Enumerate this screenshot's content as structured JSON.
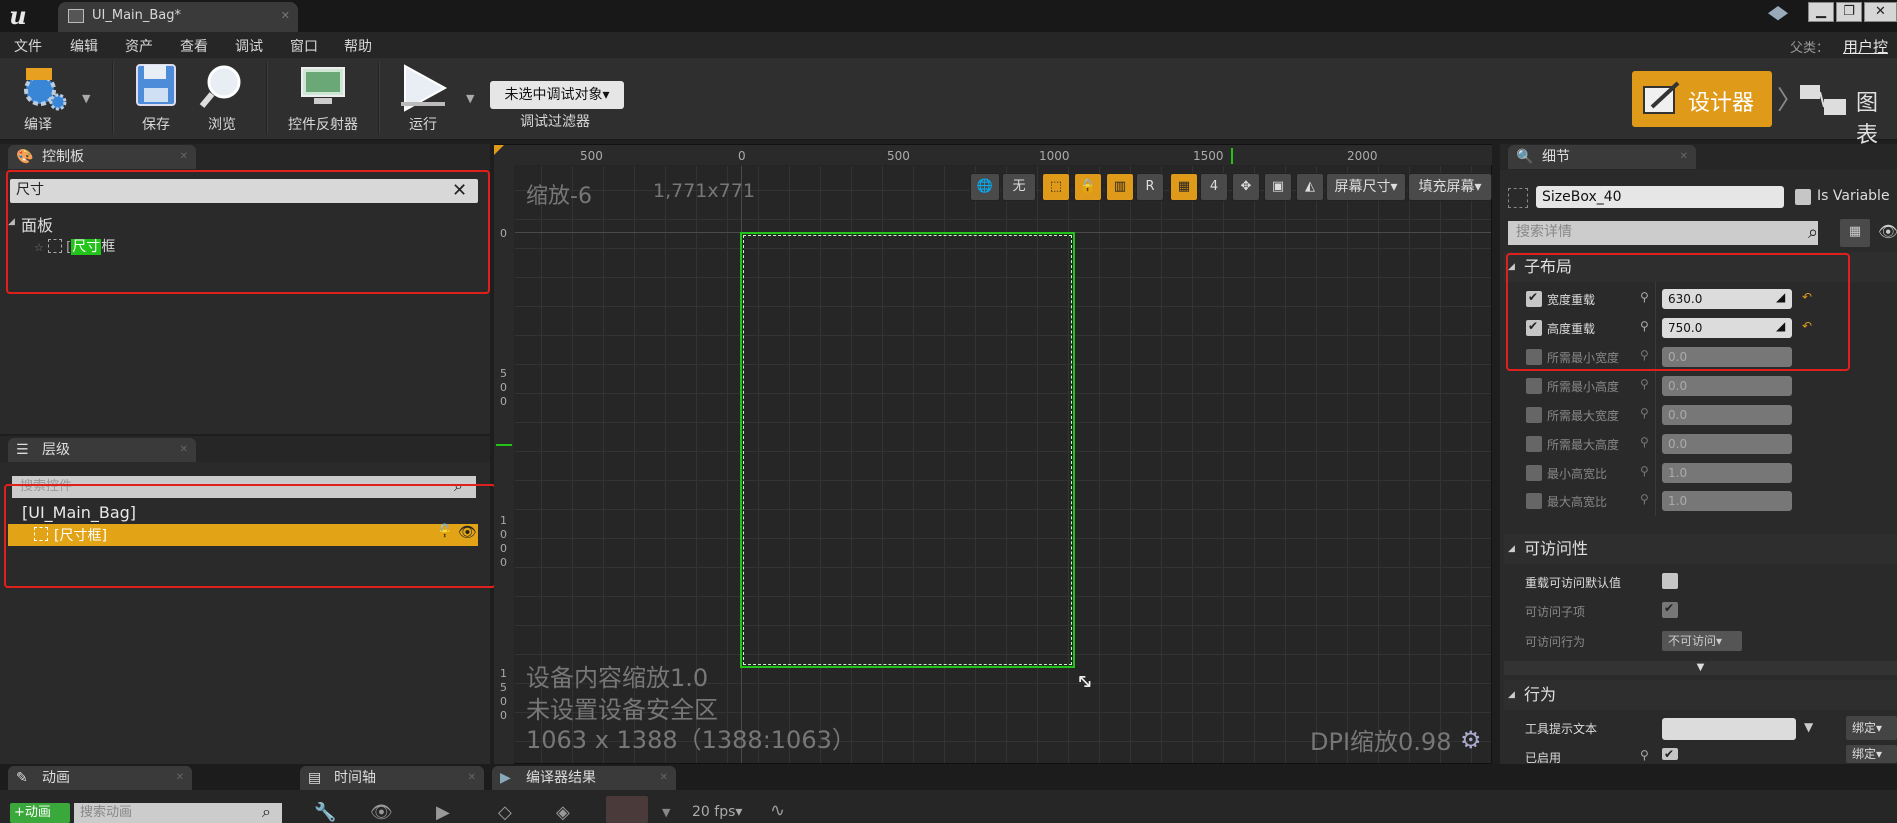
{
  "window": {
    "tab_title": "UI_Main_Bag*",
    "controls": [
      "▁",
      "❐",
      "✕"
    ]
  },
  "menu": {
    "items": [
      "文件",
      "编辑",
      "资产",
      "查看",
      "调试",
      "窗口",
      "帮助"
    ],
    "parent_label": "父类：",
    "parent_value": "用户控"
  },
  "toolbar": {
    "compile": "编译",
    "save": "保存",
    "browse": "浏览",
    "reflector": "控件反射器",
    "run": "运行",
    "debug_select": "未选中调试对象▾",
    "debug_filter": "调试过滤器",
    "designer": "设计器",
    "graph": "图表"
  },
  "palette": {
    "title": "控制板",
    "search_value": "尺寸",
    "category": "面板",
    "item_highlight": "尺寸",
    "item_suffix": "框"
  },
  "hierarchy": {
    "title": "层级",
    "search_placeholder": "搜索控件",
    "root": "[UI_Main_Bag]",
    "child": "[尺寸框]"
  },
  "canvas": {
    "zoom": "缩放-6",
    "size": "1,771x771",
    "ruler_top": [
      "500",
      "0",
      "500",
      "1000",
      "1500",
      "2000"
    ],
    "ruler_left": [
      "0",
      "5\n0\n0",
      "1\n0\n0\n0",
      "1\n5\n0\n0"
    ],
    "btn_none": "无",
    "btn_r": "R",
    "btn_4": "4",
    "screen_size": "屏幕尺寸▾",
    "fill_screen": "填充屏幕▾",
    "device_scale": "设备内容缩放1.0",
    "safe_zone": "未设置设备安全区",
    "resolution": "1063 x 1388（1388:1063）",
    "dpi": "DPI缩放0.98"
  },
  "details": {
    "title": "细节",
    "name_value": "SizeBox_40",
    "is_variable": "Is Variable",
    "search_placeholder": "搜索详情",
    "child_layout": "子布局",
    "width_override": "宽度重载",
    "width_value": "630.0",
    "height_override": "高度重载",
    "height_value": "750.0",
    "min_desired_width": "所需最小宽度",
    "min_desired_width_value": "0.0",
    "min_desired_height": "所需最小高度",
    "min_desired_height_value": "0.0",
    "max_desired_width": "所需最大宽度",
    "max_desired_width_value": "0.0",
    "max_desired_height": "所需最大高度",
    "max_desired_height_value": "0.0",
    "min_aspect": "最小高宽比",
    "min_aspect_value": "1.0",
    "max_aspect": "最大高宽比",
    "max_aspect_value": "1.0",
    "accessibility": "可访问性",
    "override_default": "重载可访问默认值",
    "accessible_children": "可访问子项",
    "accessible_behavior": "可访问行为",
    "accessible_behavior_value": "不可访问▾",
    "behavior": "行为",
    "tooltip": "工具提示文本",
    "bind": "绑定▾",
    "enabled": "已启用",
    "bind2": "绑定▾"
  },
  "bottom": {
    "tab_anim": "动画",
    "tab_timeline": "时间轴",
    "tab_compiler": "编译器结果",
    "add_anim": "+动画",
    "search_anim": "搜索动画",
    "fps": "20 fps▾"
  },
  "colors": {
    "accent_orange": "#e09a1a",
    "highlight_green": "#22c41a",
    "annotation_red": "#e0201c",
    "canvas_bg": "#262626"
  }
}
